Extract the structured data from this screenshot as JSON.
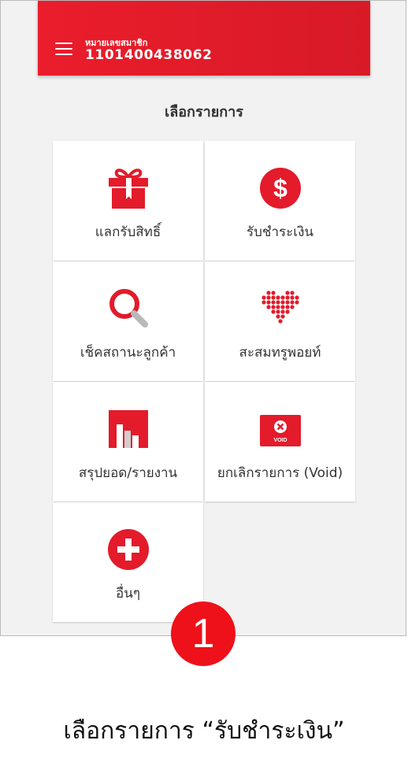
{
  "header": {
    "member_label": "หมายเลขสมาชิก",
    "member_number": "1101400438062",
    "menu_icon": "hamburger-menu-icon",
    "brand_color": "#e31b2b"
  },
  "page": {
    "title": "เลือกรายการ"
  },
  "menu_items": [
    {
      "label": "แลกรับสิทธิ์",
      "icon": "gift-icon"
    },
    {
      "label": "รับชำระเงิน",
      "icon": "dollar-coin-icon"
    },
    {
      "label": "เช็คสถานะลูกค้า",
      "icon": "magnifier-icon"
    },
    {
      "label": "สะสมทรูพอยท์",
      "icon": "dotted-heart-icon"
    },
    {
      "label": "สรุปยอด/รายงาน",
      "icon": "bar-report-icon"
    },
    {
      "label": "ยกเลิกรายการ (Void)",
      "icon": "void-ticket-icon",
      "icon_text": "VOID"
    },
    {
      "label": "อื่นๆ",
      "icon": "plus-circle-icon"
    }
  ],
  "annotation": {
    "step_number": "1",
    "caption": "เลือกรายการ “รับชำระเงิน”"
  },
  "colors": {
    "accent": "#e31b2b",
    "background": "#f2f2f2",
    "tile": "#ffffff"
  }
}
